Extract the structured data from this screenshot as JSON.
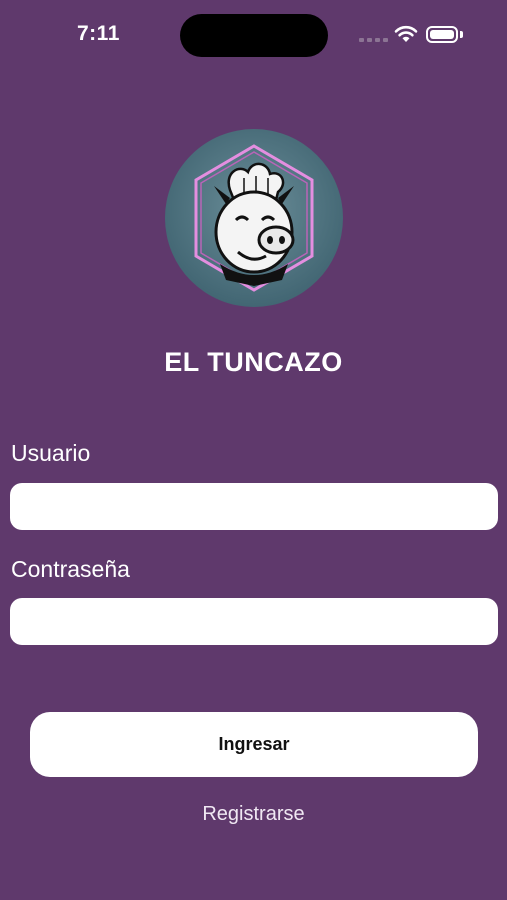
{
  "status_bar": {
    "time": "7:11",
    "icons": [
      "cellular-signal-icon",
      "wifi-icon",
      "battery-icon"
    ]
  },
  "app": {
    "title": "EL TUNCAZO",
    "logo": "chef-pig-logo"
  },
  "form": {
    "username_label": "Usuario",
    "username_value": "",
    "password_label": "Contraseña",
    "password_value": ""
  },
  "actions": {
    "login_label": "Ingresar",
    "register_label": "Registrarse"
  },
  "colors": {
    "background": "#5f396c",
    "field": "#ffffff",
    "button": "#ffffff",
    "logo_hexagon": "#e48ee0",
    "logo_disc": "#4e7280"
  }
}
